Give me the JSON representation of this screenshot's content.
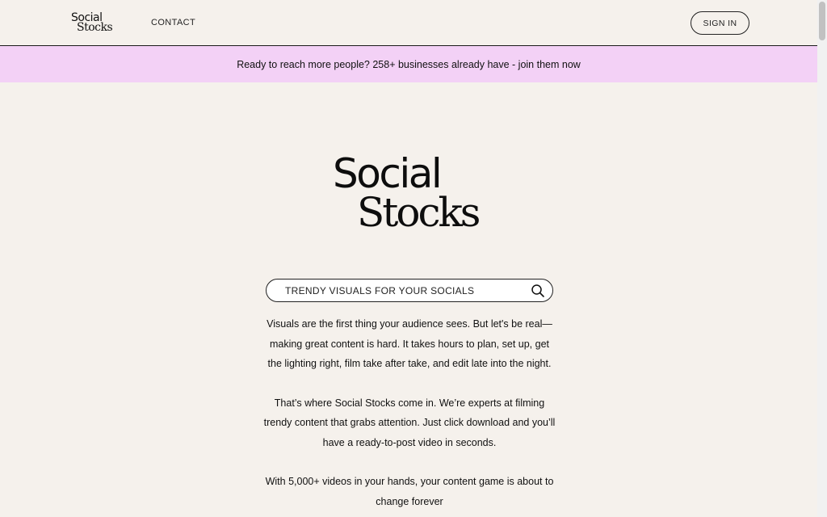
{
  "nav": {
    "logo_line1": "Social",
    "logo_line2": "Stocks",
    "contact_label": "CONTACT",
    "signin_label": "SIGN IN"
  },
  "banner": {
    "text": "Ready to reach more people? 258+ businesses already have - join them now"
  },
  "hero": {
    "logo_line1": "Social",
    "logo_line2": "Stocks"
  },
  "search": {
    "text": "TRENDY VISUALS FOR YOUR SOCIALS",
    "icon": "search-icon"
  },
  "content": {
    "paragraph1_line1": "Visuals are the first thing your audience sees. But let's be real—",
    "paragraph1_line2": "making great content is hard. It takes hours to plan, set up, get",
    "paragraph1_line3": "the lighting right, film take after take, and edit late into the night.",
    "paragraph2_line1": "That’s where Social Stocks come in. We’re experts at filming",
    "paragraph2_line2": "trendy content that grabs attention. Just click download and you’ll",
    "paragraph2_line3": "have a ready-to-post video in seconds.",
    "paragraph3_line1": "With 5,000+ videos in your hands, your content game is about to",
    "paragraph3_line2": "change forever"
  },
  "colors": {
    "background": "#f5f1ec",
    "banner": "#f3d1f6",
    "text": "#111111"
  }
}
